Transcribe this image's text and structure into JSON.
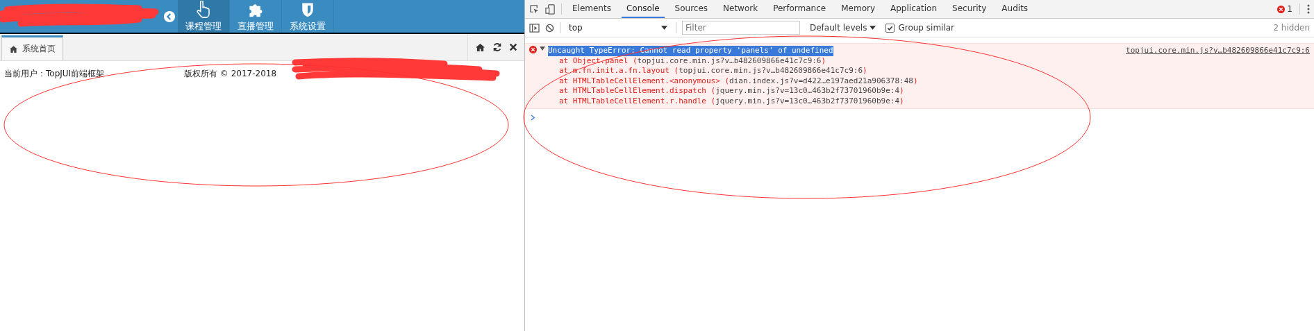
{
  "app": {
    "nav": [
      {
        "label": "课程管理",
        "selected": true
      },
      {
        "label": "直播管理",
        "selected": false
      },
      {
        "label": "系统设置",
        "selected": false
      }
    ],
    "tabs": [
      {
        "label": "系统首页",
        "selected": true
      }
    ],
    "footer": {
      "user": "当前用户：TopJUI前端框架",
      "copyright": "版权所有 © 2017-2018"
    }
  },
  "devtools": {
    "tabs": [
      {
        "label": "Elements",
        "selected": false
      },
      {
        "label": "Console",
        "selected": true
      },
      {
        "label": "Sources",
        "selected": false
      },
      {
        "label": "Network",
        "selected": false
      },
      {
        "label": "Performance",
        "selected": false
      },
      {
        "label": "Memory",
        "selected": false
      },
      {
        "label": "Application",
        "selected": false
      },
      {
        "label": "Security",
        "selected": false
      },
      {
        "label": "Audits",
        "selected": false
      }
    ],
    "error_count": "1",
    "context": "top",
    "filter": {
      "placeholder": "Filter"
    },
    "levels": "Default levels",
    "group_similar": {
      "label": "Group similar",
      "checked": true
    },
    "hidden": "2 hidden",
    "messages": [
      {
        "kind": "error",
        "expanded": true,
        "highlighted": true,
        "text": "Uncaught TypeError: Cannot read property 'panels' of undefined",
        "source": "topjui.core.min.js?v…b482609866e41c7c9:6",
        "stack": [
          {
            "call": "at Object.panel (",
            "link": "topjui.core.min.js?v…b482609866e41c7c9:6",
            "end": ")"
          },
          {
            "call": "at m.fn.init.a.fn.layout (",
            "link": "topjui.core.min.js?v…b482609866e41c7c9:6",
            "end": ")"
          },
          {
            "call": "at HTMLTableCellElement.<anonymous> (",
            "link": "dian.index.js?v=d422…e197aed21a906378:48",
            "end": ")"
          },
          {
            "call": "at HTMLTableCellElement.dispatch (",
            "link": "jquery.min.js?v=13c0…463b2f73701960b9e:4",
            "end": ")"
          },
          {
            "call": "at HTMLTableCellElement.r.handle (",
            "link": "jquery.min.js?v=13c0…463b2f73701960b9e:4",
            "end": ")"
          }
        ]
      }
    ]
  },
  "annotations": [
    {
      "kind": "scribble"
    },
    {
      "kind": "scribble"
    },
    {
      "kind": "ellipse"
    },
    {
      "kind": "ellipse"
    }
  ]
}
